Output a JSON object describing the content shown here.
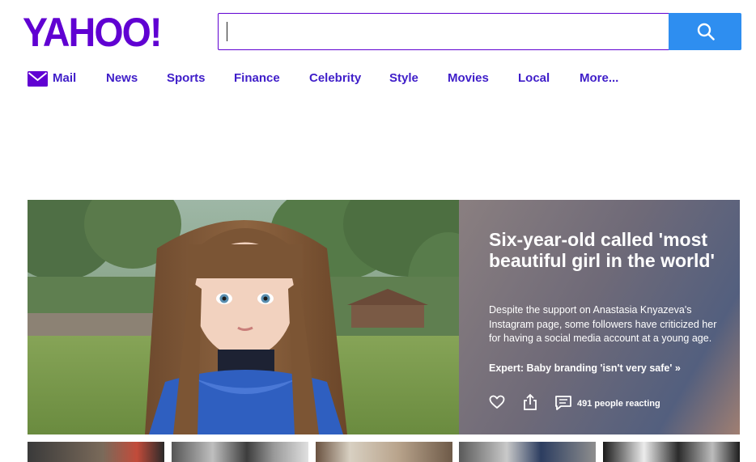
{
  "header": {
    "logo_text": "YAHOO!",
    "search": {
      "value": "",
      "placeholder": "",
      "button_icon": "search-icon"
    },
    "brand_color": "#6001d2",
    "search_button_color": "#2e8ef0"
  },
  "nav": {
    "items": [
      {
        "label": "Mail",
        "icon": "mail-icon"
      },
      {
        "label": "News"
      },
      {
        "label": "Sports"
      },
      {
        "label": "Finance"
      },
      {
        "label": "Celebrity"
      },
      {
        "label": "Style"
      },
      {
        "label": "Movies"
      },
      {
        "label": "Local"
      },
      {
        "label": "More..."
      }
    ]
  },
  "hero": {
    "title": "Six-year-old called 'most beautiful girl in the world'",
    "description": "Despite the support on Anastasia Knyazeva's Instagram page, some followers have criticized her for having a social media account at a young age.",
    "related_link": "Expert: Baby branding 'isn't very safe' »",
    "reactions": "491 people reacting",
    "actions": [
      "heart-icon",
      "share-icon",
      "comment-icon"
    ]
  },
  "thumbnails": [
    {
      "name": "thumbnail-1"
    },
    {
      "name": "thumbnail-2"
    },
    {
      "name": "thumbnail-3"
    },
    {
      "name": "thumbnail-4"
    },
    {
      "name": "thumbnail-5"
    }
  ]
}
